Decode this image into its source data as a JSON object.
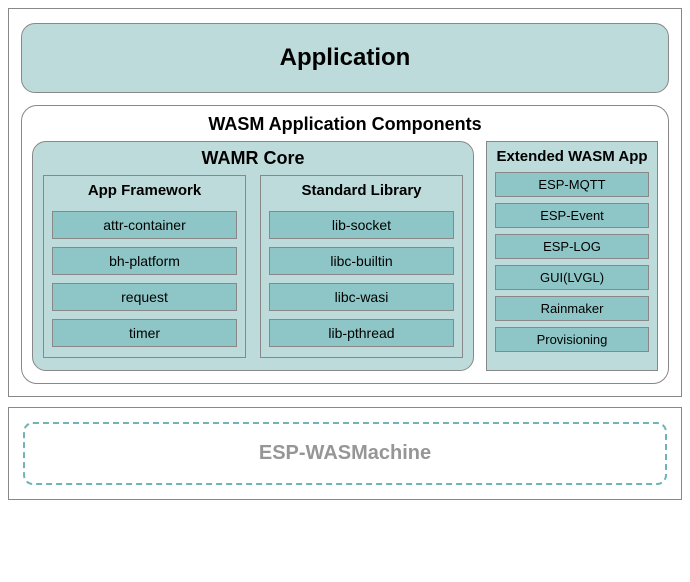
{
  "application": {
    "title": "Application"
  },
  "wasmComponents": {
    "title": "WASM Application Components",
    "wamrCore": {
      "title": "WAMR Core",
      "appFramework": {
        "title": "App Framework",
        "items": [
          "attr-container",
          "bh-platform",
          "request",
          "timer"
        ]
      },
      "standardLibrary": {
        "title": "Standard Library",
        "items": [
          "lib-socket",
          "libc-builtin",
          "libc-wasi",
          "lib-pthread"
        ]
      }
    },
    "extended": {
      "title": "Extended WASM App",
      "items": [
        "ESP-MQTT",
        "ESP-Event",
        "ESP-LOG",
        "GUI(LVGL)",
        "Rainmaker",
        "Provisioning"
      ]
    }
  },
  "wasmachine": {
    "title": "ESP-WASMachine"
  }
}
